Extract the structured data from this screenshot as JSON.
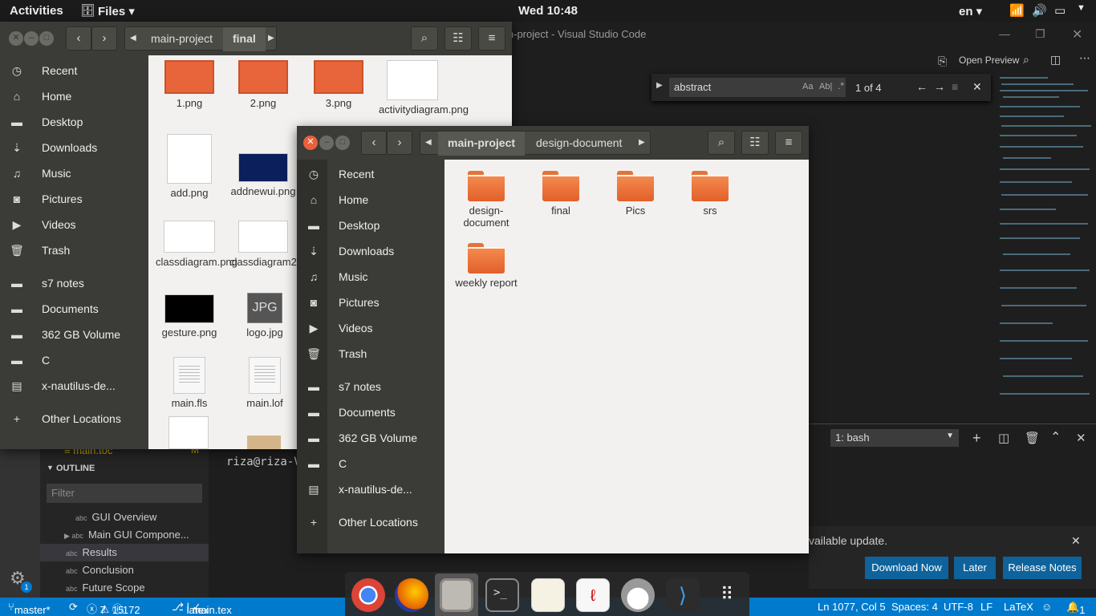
{
  "topbar": {
    "activities": "Activities",
    "app_menu": "Files ▾",
    "clock": "Wed 10:48",
    "lang": "en ▾"
  },
  "vscode": {
    "title": "in-project - Visual Studio Code",
    "open_preview": "Open Preview",
    "find": {
      "query": "abstract",
      "count": "1 of 4",
      "aa": "Aa",
      "ab": "Ab|",
      "regex": ".*"
    },
    "terminal": {
      "shell": "1: bash",
      "prompt": "riza@riza-V"
    },
    "tree_file": "main.toc",
    "tree_badge": "M",
    "outline": {
      "header": "OUTLINE",
      "filter_placeholder": "Filter",
      "items": [
        "GUI Overview",
        "Main GUI Compone...",
        "Results",
        "Conclusion",
        "Future Scope"
      ]
    },
    "notification": {
      "text": "vailable update.",
      "download": "Download Now",
      "later": "Later",
      "release": "Release Notes"
    },
    "status": {
      "branch": "master*",
      "errors": "7",
      "warnings": "15",
      "info": "172",
      "lang_mode": "latex",
      "file": "main.tex",
      "position": "Ln 1077, Col 5",
      "spaces": "Spaces: 4",
      "encoding": "UTF-8",
      "eol": "LF",
      "language": "LaTeX",
      "bell": "1",
      "gear_badge": "1"
    }
  },
  "nautilus_back": {
    "breadcrumbs": [
      "main-project",
      "final"
    ],
    "sidebar": [
      "Recent",
      "Home",
      "Desktop",
      "Downloads",
      "Music",
      "Pictures",
      "Videos",
      "Trash",
      "s7 notes",
      "Documents",
      "362 GB Volume",
      "C",
      "x-nautilus-de...",
      "Other Locations"
    ],
    "files": [
      "1.png",
      "2.png",
      "3.png",
      "activitydiagram.png",
      "add.png",
      "addnewui.png",
      "classdiagram.png",
      "classdiagram2.png",
      "gesture.png",
      "logo.jpg",
      "main.fls",
      "main.lof"
    ],
    "jpg_label": "JPG"
  },
  "nautilus_front": {
    "breadcrumbs": [
      "main-project",
      "design-document"
    ],
    "sidebar": [
      "Recent",
      "Home",
      "Desktop",
      "Downloads",
      "Music",
      "Pictures",
      "Videos",
      "Trash",
      "s7 notes",
      "Documents",
      "362 GB Volume",
      "C",
      "x-nautilus-de...",
      "Other Locations"
    ],
    "folders": [
      "design-document",
      "final",
      "Pics",
      "srs",
      "weekly report"
    ]
  },
  "icons": [
    "clock-icon",
    "home-icon",
    "folder-icon",
    "download-icon",
    "music-icon",
    "camera-icon",
    "video-icon",
    "trash-icon",
    "drive-icon",
    "plus-icon"
  ]
}
